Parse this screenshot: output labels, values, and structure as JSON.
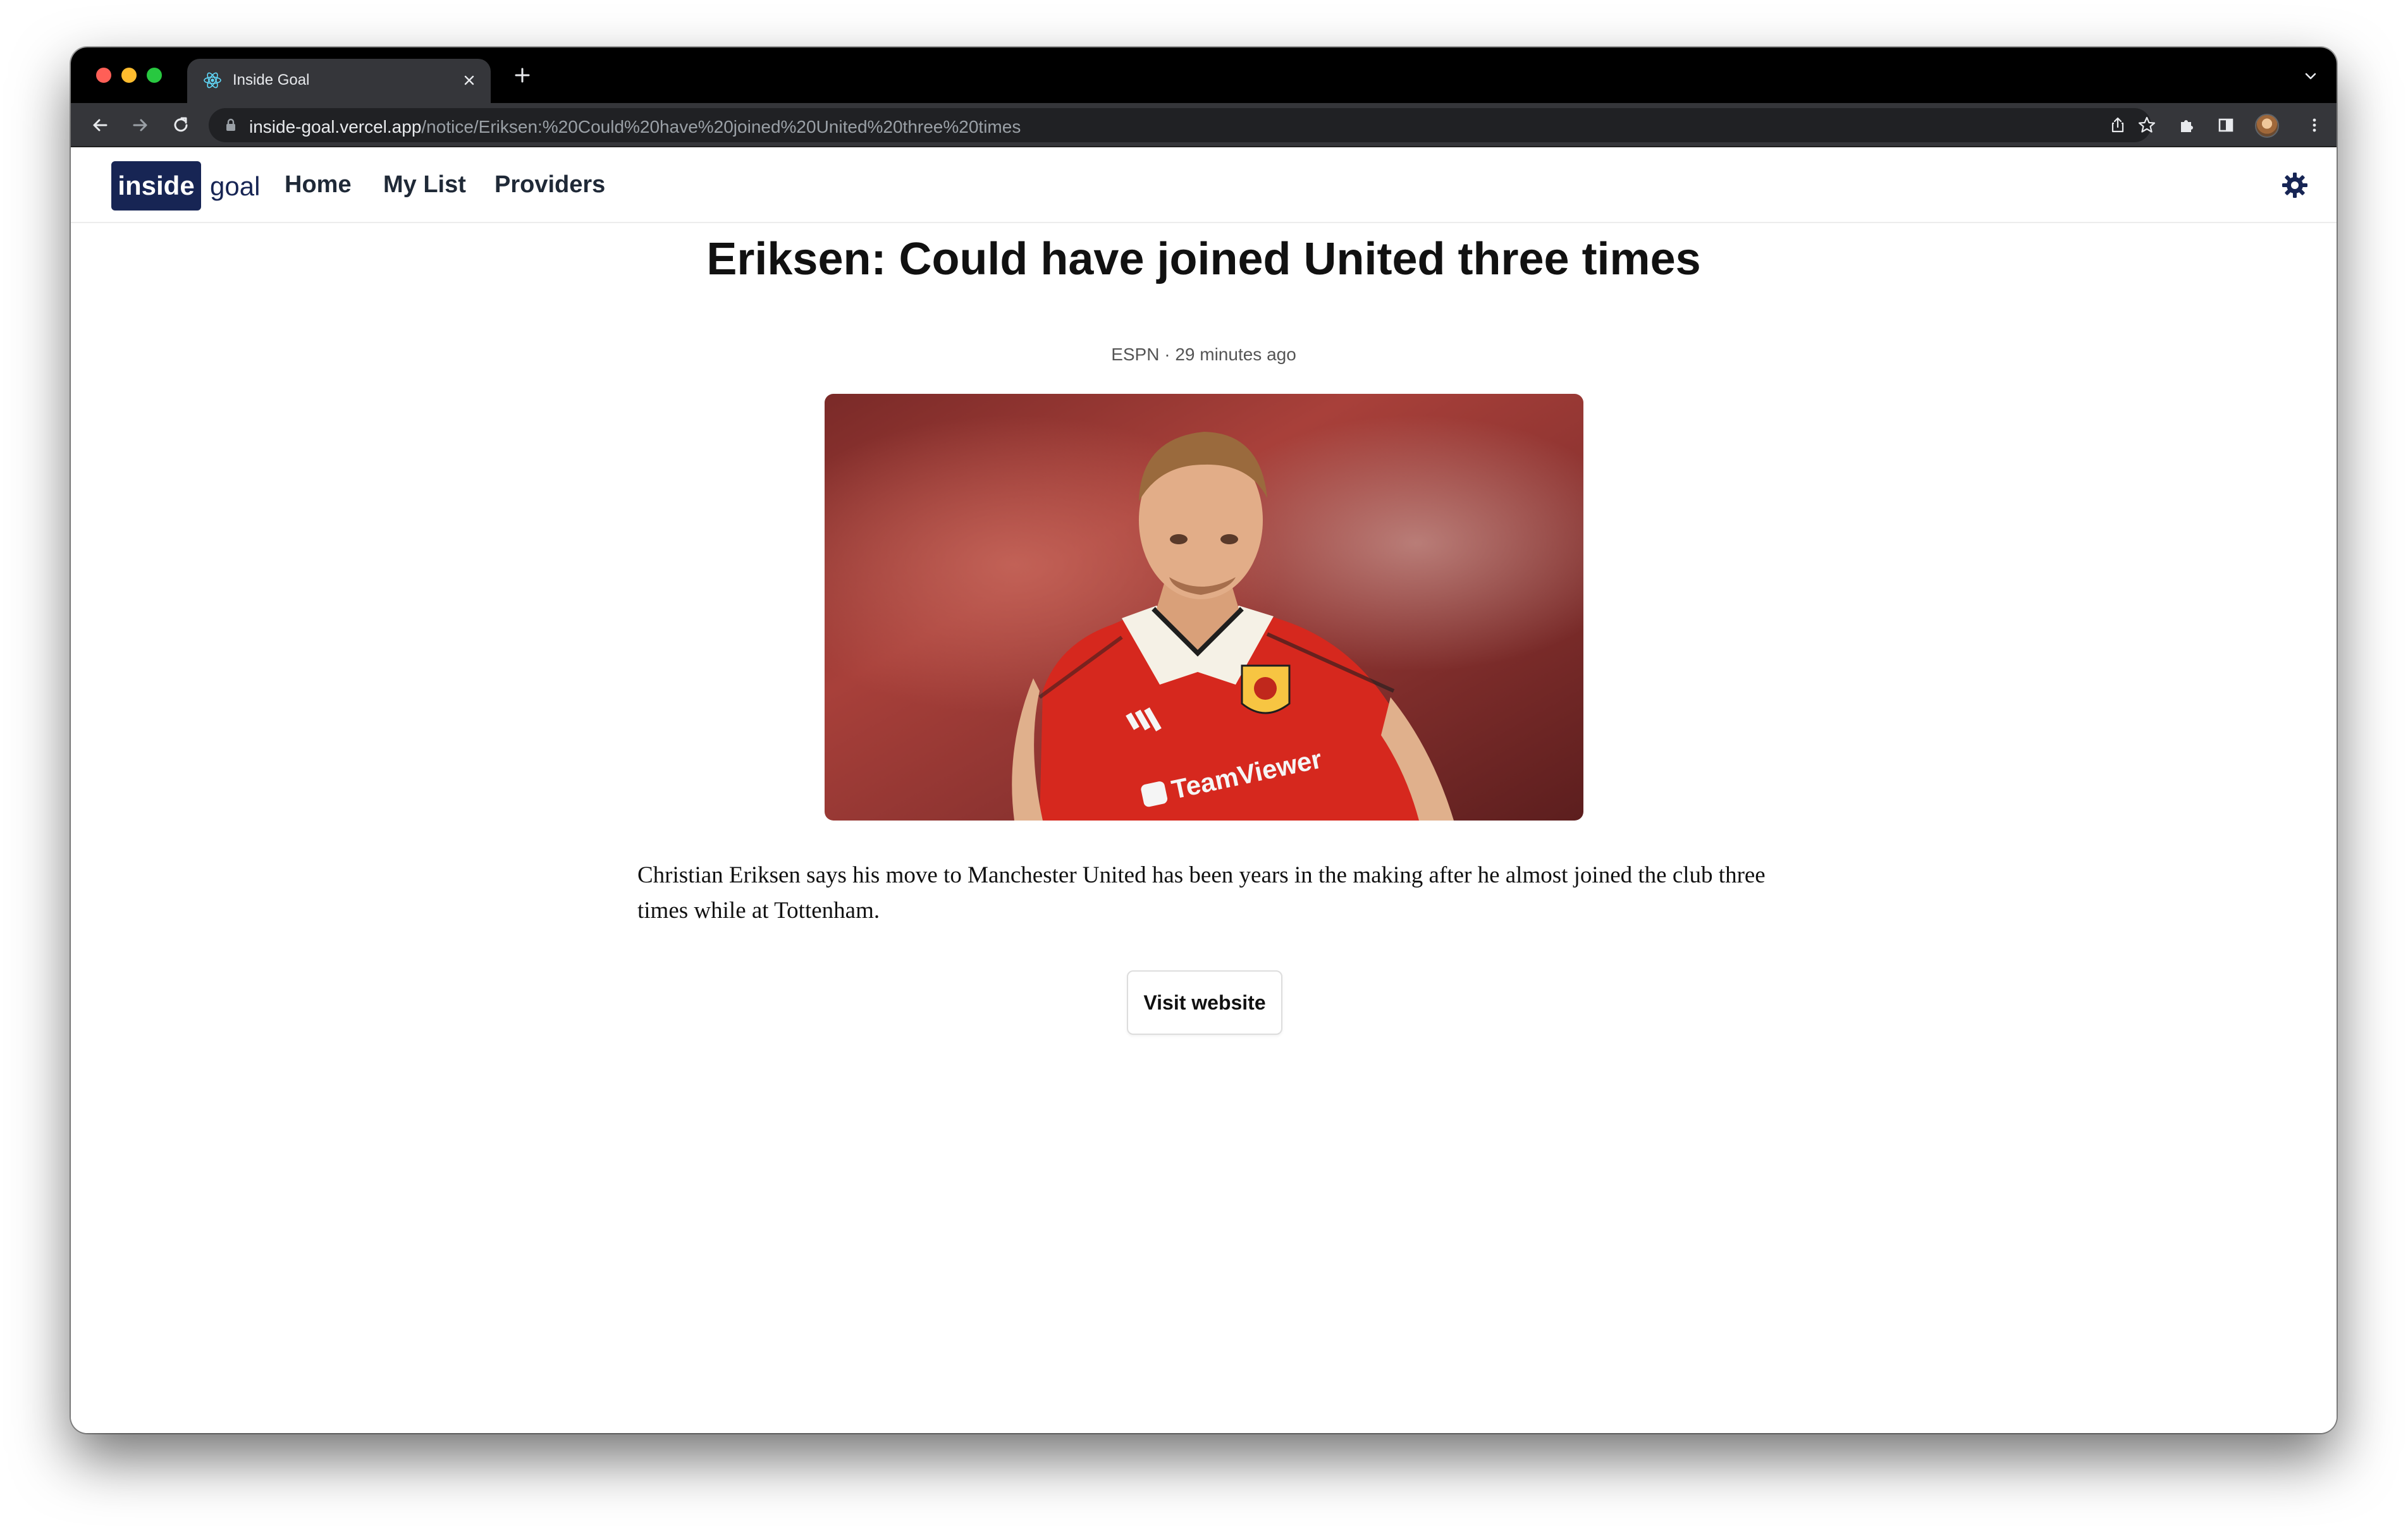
{
  "browser": {
    "tab_title": "Inside Goal",
    "url_host": "inside-goal.vercel.app",
    "url_path": "/notice/Eriksen:%20Could%20have%20joined%20United%20three%20times"
  },
  "site": {
    "logo_box_text": "inside",
    "logo_word": "goal",
    "nav": [
      {
        "label": "Home"
      },
      {
        "label": "My List"
      },
      {
        "label": "Providers"
      }
    ],
    "theme_icon": "gear-icon"
  },
  "article": {
    "title": "Eriksen: Could have joined United three times",
    "meta": "ESPN · 29 minutes ago",
    "summary": "Christian Eriksen says his move to Manchester United has been years in the making after he almost joined the club three times while at Tottenham.",
    "image_alt": "Christian Eriksen in Manchester United shirt",
    "shirt_sponsor": "TeamViewer",
    "visit_label": "Visit website"
  },
  "colors": {
    "brand": "#172554",
    "shirt_red": "#da291c"
  }
}
